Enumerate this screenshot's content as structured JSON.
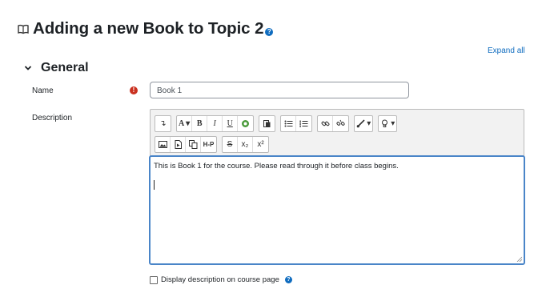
{
  "page": {
    "title": "Adding a new Book to Topic 2",
    "help_glyph": "?",
    "expand_all": "Expand all"
  },
  "section": {
    "title": "General"
  },
  "form": {
    "name_label": "Name",
    "required_glyph": "!",
    "name_value": "Book 1",
    "description_label": "Description",
    "description_text": "This is Book 1 for the course. Please read through it before class begins.",
    "display_description_label": "Display description on course page"
  },
  "toolbar": {
    "row1": [
      [
        {
          "icon": "collapse-icon",
          "glyph": "↴"
        }
      ],
      [
        {
          "icon": "font-style-icon",
          "glyph": "A ▾"
        },
        {
          "icon": "bold-icon",
          "glyph": "B"
        },
        {
          "icon": "italic-icon",
          "glyph": "I"
        },
        {
          "icon": "underline-icon",
          "glyph": "U"
        },
        {
          "icon": "accessibility-icon",
          "glyph": ""
        }
      ],
      [
        {
          "icon": "paste-icon",
          "glyph": ""
        }
      ],
      [
        {
          "icon": "unordered-list-icon",
          "glyph": ""
        },
        {
          "icon": "ordered-list-icon",
          "glyph": ""
        }
      ],
      [
        {
          "icon": "link-icon",
          "glyph": ""
        },
        {
          "icon": "unlink-icon",
          "glyph": ""
        }
      ],
      [
        {
          "icon": "brush-icon",
          "glyph": "▾"
        }
      ],
      [
        {
          "icon": "lightbulb-icon",
          "glyph": "▾"
        }
      ]
    ],
    "row2": [
      [
        {
          "icon": "image-icon",
          "glyph": ""
        },
        {
          "icon": "media-icon",
          "glyph": ""
        },
        {
          "icon": "manage-files-icon",
          "glyph": ""
        },
        {
          "icon": "h5p-icon",
          "glyph": "H-P"
        }
      ],
      [
        {
          "icon": "strikethrough-icon",
          "glyph": "S"
        },
        {
          "icon": "subscript-icon",
          "glyph": "x₂"
        },
        {
          "icon": "superscript-icon",
          "glyph": "x²"
        }
      ]
    ]
  },
  "colors": {
    "link": "#0f6cbf",
    "required": "#ca3120",
    "focus": "#4a85c8"
  }
}
